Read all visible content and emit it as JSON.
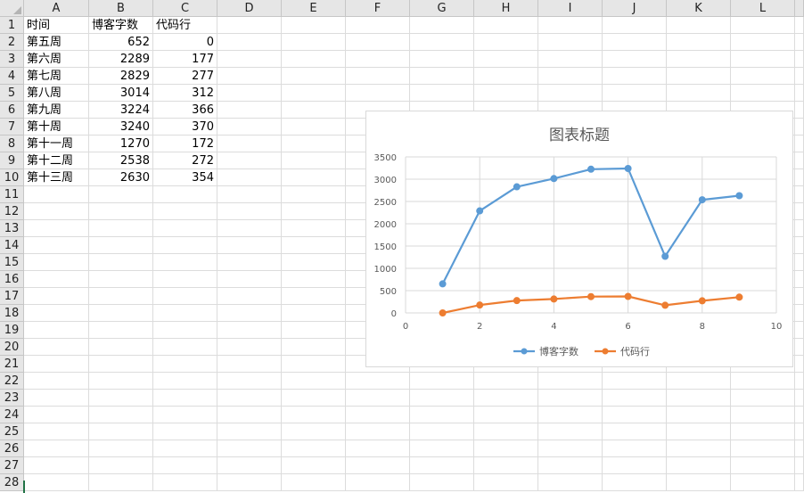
{
  "columns": [
    "A",
    "B",
    "C",
    "D",
    "E",
    "F",
    "G",
    "H",
    "I",
    "J",
    "K",
    "L"
  ],
  "rows": [
    "1",
    "2",
    "3",
    "4",
    "5",
    "6",
    "7",
    "8",
    "9",
    "10",
    "11",
    "12",
    "13",
    "14",
    "15",
    "16",
    "17",
    "18",
    "19",
    "20",
    "21",
    "22",
    "23",
    "24",
    "25",
    "26",
    "27",
    "28"
  ],
  "table": [
    [
      "时间",
      "博客字数",
      "代码行"
    ],
    [
      "第五周",
      "652",
      "0"
    ],
    [
      "第六周",
      "2289",
      "177"
    ],
    [
      "第七周",
      "2829",
      "277"
    ],
    [
      "第八周",
      "3014",
      "312"
    ],
    [
      "第九周",
      "3224",
      "366"
    ],
    [
      "第十周",
      "3240",
      "370"
    ],
    [
      "第十一周",
      "1270",
      "172"
    ],
    [
      "第十二周",
      "2538",
      "272"
    ],
    [
      "第十三周",
      "2630",
      "354"
    ]
  ],
  "chart_data": {
    "type": "scatter",
    "title": "图表标题",
    "x": [
      1,
      2,
      3,
      4,
      5,
      6,
      7,
      8,
      9
    ],
    "series": [
      {
        "name": "博客字数",
        "values": [
          652,
          2289,
          2829,
          3014,
          3224,
          3240,
          1270,
          2538,
          2630
        ],
        "color": "#5b9bd5"
      },
      {
        "name": "代码行",
        "values": [
          0,
          177,
          277,
          312,
          366,
          370,
          172,
          272,
          354
        ],
        "color": "#ed7d31"
      }
    ],
    "xlim": [
      0,
      10
    ],
    "ylim": [
      0,
      3500
    ],
    "xticks": [
      0,
      2,
      4,
      6,
      8,
      10
    ],
    "yticks": [
      0,
      500,
      1000,
      1500,
      2000,
      2500,
      3000,
      3500
    ],
    "grid": true,
    "legend": "bottom"
  }
}
